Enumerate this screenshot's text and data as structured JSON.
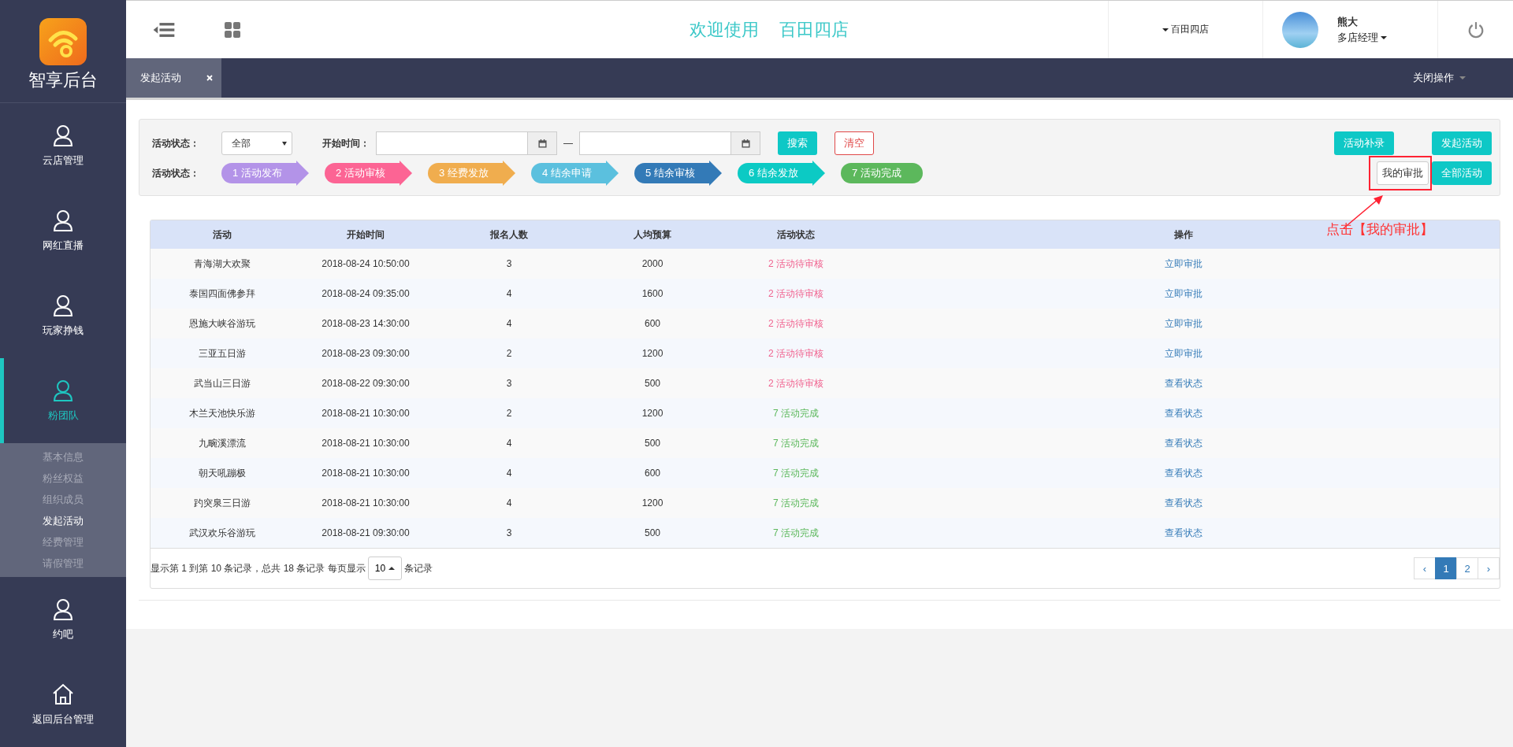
{
  "sidebar": {
    "logo_text": "智享后台",
    "items": [
      {
        "label": "云店管理",
        "selected": false
      },
      {
        "label": "网红直播",
        "selected": false
      },
      {
        "label": "玩家挣钱",
        "selected": false
      },
      {
        "label": "粉团队",
        "selected": true,
        "children": [
          {
            "label": "基本信息",
            "selected": false
          },
          {
            "label": "粉丝权益",
            "selected": false
          },
          {
            "label": "组织成员",
            "selected": false
          },
          {
            "label": "发起活动",
            "selected": true
          },
          {
            "label": "经费管理",
            "selected": false
          },
          {
            "label": "请假管理",
            "selected": false
          }
        ]
      },
      {
        "label": "约吧",
        "selected": false
      },
      {
        "label": "返回后台管理",
        "selected": false
      }
    ]
  },
  "header": {
    "welcome": "欢迎使用",
    "store_title": "百田四店",
    "store_menu": "百田四店",
    "user_name": "熊大",
    "user_role": "多店经理"
  },
  "tabs": [
    {
      "label": "发起活动"
    }
  ],
  "tab_bar_menu": "关闭操作",
  "filter": {
    "status_label": "活动状态：",
    "status_value": "全部",
    "time_label": "开始时间：",
    "date_separator": "—",
    "search_button": "搜索",
    "clear_button": "清空",
    "supplement_button": "活动补录",
    "launch_button": "发起活动",
    "steps_label": "活动状态：",
    "steps": [
      {
        "label": "1 活动发布",
        "color": "#b393e8",
        "kind": "arrow"
      },
      {
        "label": "2 活动审核",
        "color": "#fc6494",
        "kind": "arrow"
      },
      {
        "label": "3 经费发放",
        "color": "#f0ad4e",
        "kind": "arrow"
      },
      {
        "label": "4 结余申请",
        "color": "#5bc0de",
        "kind": "arrow"
      },
      {
        "label": "5 结余审核",
        "color": "#337ab7",
        "kind": "arrow"
      },
      {
        "label": "6 结余发放",
        "color": "#0ccac4",
        "kind": "arrow"
      },
      {
        "label": "7 活动完成",
        "color": "#5cb85c",
        "kind": "pill"
      }
    ],
    "view_buttons": [
      {
        "label": "我的审批",
        "selected": true
      },
      {
        "label": "全部活动",
        "selected": false
      }
    ]
  },
  "annotation": {
    "text": "点击【我的审批】"
  },
  "table": {
    "columns": [
      "活动",
      "开始时间",
      "报名人数",
      "人均预算",
      "活动状态",
      "操作"
    ],
    "rows": [
      {
        "name": "青海湖大欢聚",
        "start": "2018-08-24 10:50:00",
        "count": "3",
        "budget": "2000",
        "status": "2 活动待审核",
        "color": "#f0628f",
        "action": "立即审批"
      },
      {
        "name": "泰国四面佛参拜",
        "start": "2018-08-24 09:35:00",
        "count": "4",
        "budget": "1600",
        "status": "2 活动待审核",
        "color": "#f0628f",
        "action": "立即审批"
      },
      {
        "name": "恩施大峡谷游玩",
        "start": "2018-08-23 14:30:00",
        "count": "4",
        "budget": "600",
        "status": "2 活动待审核",
        "color": "#f0628f",
        "action": "立即审批"
      },
      {
        "name": "三亚五日游",
        "start": "2018-08-23 09:30:00",
        "count": "2",
        "budget": "1200",
        "status": "2 活动待审核",
        "color": "#f0628f",
        "action": "立即审批"
      },
      {
        "name": "武当山三日游",
        "start": "2018-08-22 09:30:00",
        "count": "3",
        "budget": "500",
        "status": "2 活动待审核",
        "color": "#f0628f",
        "action": "查看状态"
      },
      {
        "name": "木兰天池快乐游",
        "start": "2018-08-21 10:30:00",
        "count": "2",
        "budget": "1200",
        "status": "7 活动完成",
        "color": "#5cb85c",
        "action": "查看状态"
      },
      {
        "name": "九畹溪漂流",
        "start": "2018-08-21 10:30:00",
        "count": "4",
        "budget": "500",
        "status": "7 活动完成",
        "color": "#5cb85c",
        "action": "查看状态"
      },
      {
        "name": "朝天吼蹦极",
        "start": "2018-08-21 10:30:00",
        "count": "4",
        "budget": "600",
        "status": "7 活动完成",
        "color": "#5cb85c",
        "action": "查看状态"
      },
      {
        "name": "趵突泉三日游",
        "start": "2018-08-21 10:30:00",
        "count": "4",
        "budget": "1200",
        "status": "7 活动完成",
        "color": "#5cb85c",
        "action": "查看状态"
      },
      {
        "name": "武汉欢乐谷游玩",
        "start": "2018-08-21 09:30:00",
        "count": "3",
        "budget": "500",
        "status": "7 活动完成",
        "color": "#5cb85c",
        "action": "查看状态"
      }
    ],
    "summary": "显示第 1 到第 10 条记录，总共 18 条记录 每页显示",
    "page_size": "10",
    "page_size_suffix": "条记录",
    "pages": [
      {
        "label": "‹",
        "selected": false
      },
      {
        "label": "1",
        "selected": true
      },
      {
        "label": "2",
        "selected": false
      },
      {
        "label": "›",
        "selected": false
      }
    ]
  }
}
